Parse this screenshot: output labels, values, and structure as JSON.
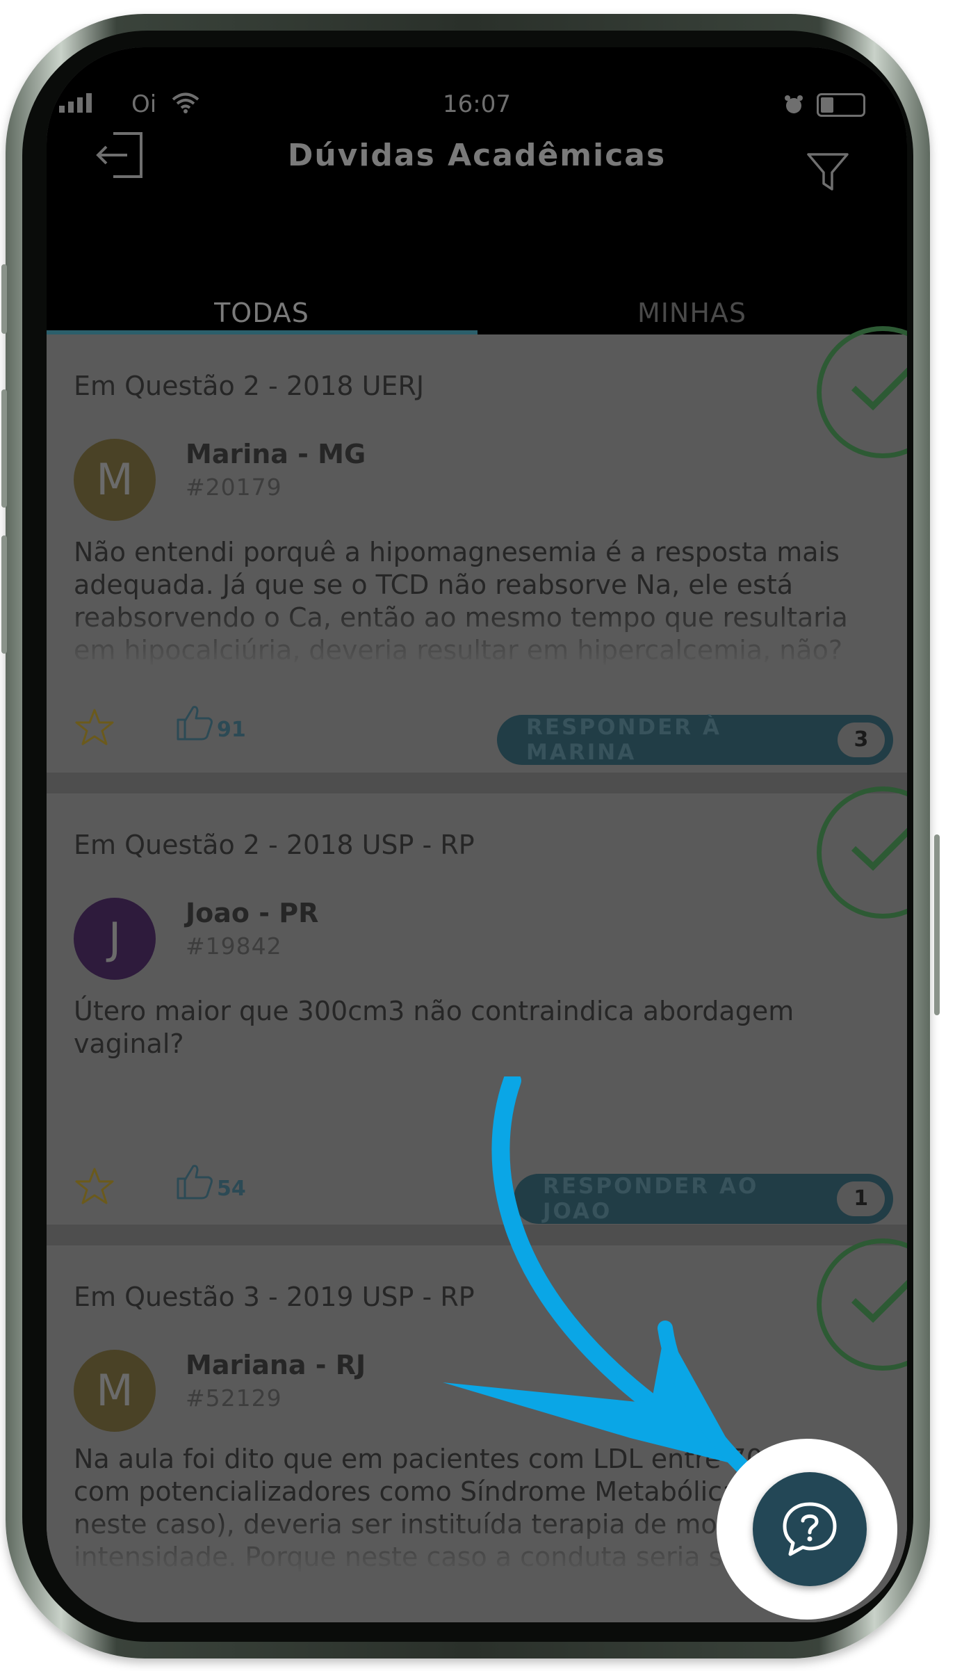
{
  "status_bar": {
    "carrier": "Oi",
    "time": "16:07"
  },
  "header": {
    "title": "Dúvidas Acadêmicas"
  },
  "tabs": [
    {
      "label": "TODAS",
      "active": true
    },
    {
      "label": "MINHAS",
      "active": false
    }
  ],
  "cards": [
    {
      "reference": "Em Questão 2 - 2018 UERJ",
      "avatar_letter": "M",
      "avatar_color": "#4a4226",
      "user_name": "Marina - MG",
      "user_id": "#20179",
      "question": "Não entendi porquê a hipomagnesemia é a resposta mais adequada. Já que se o TCD não reabsorve Na, ele está reabsorvendo o Ca, então ao mesmo tempo que resultaria em hipocalciúria, deveria resultar em hipercalcemia, não? Porquê",
      "likes": "91",
      "reply_label": "RESPONDER À MARINA",
      "reply_count": "3"
    },
    {
      "reference": "Em Questão 2 - 2018 USP - RP",
      "avatar_letter": "J",
      "avatar_color": "#2e1b3c",
      "user_name": "Joao - PR",
      "user_id": "#19842",
      "question": "Útero maior que 300cm3 não contraindica abordagem vaginal?",
      "likes": "54",
      "reply_label": "RESPONDER AO JOAO",
      "reply_count": "1"
    },
    {
      "reference": "Em Questão 3 - 2019 USP - RP",
      "avatar_letter": "M",
      "avatar_color": "#4a4226",
      "user_name": "Mariana - RJ",
      "user_id": "#52129",
      "question": "Na aula foi dito que em pacientes com LDL entre 70-189 com potencializadores como Síndrome Metabólica (como neste caso), deveria ser instituída terapia de moderada intensidade. Porque neste caso a conduta seria suspender a sinvastatina?"
    }
  ],
  "colors": {
    "accent": "#234756",
    "tab_indicator": "#2b5f6b",
    "check": "#2d5a34",
    "annotation_arrow": "#0aa6e6",
    "star": "#6b5a1c"
  },
  "icons": [
    "signal-icon",
    "wifi-icon",
    "alarm-icon",
    "battery-icon",
    "logout-icon",
    "filter-icon",
    "check-icon",
    "star-icon",
    "thumbs-up-icon",
    "question-chat-icon",
    "annotation-arrow"
  ]
}
